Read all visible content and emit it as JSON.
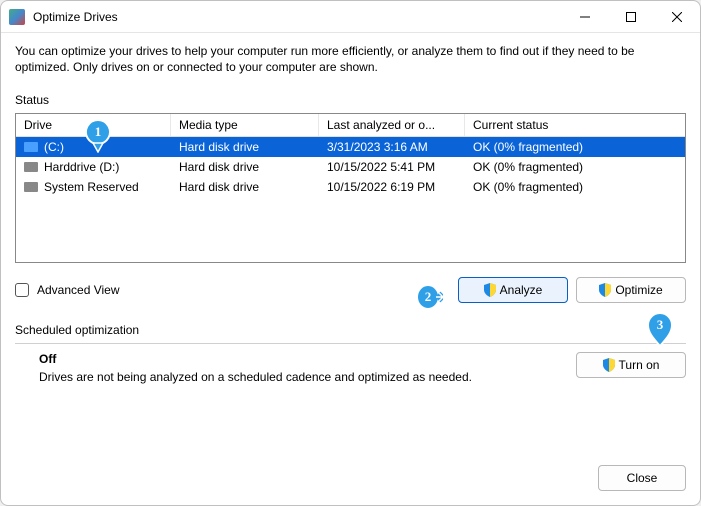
{
  "window": {
    "title": "Optimize Drives"
  },
  "description": "You can optimize your drives to help your computer run more efficiently, or analyze them to find out if they need to be optimized. Only drives on or connected to your computer are shown.",
  "status_label": "Status",
  "columns": {
    "drive": "Drive",
    "media": "Media type",
    "last": "Last analyzed or o...",
    "status": "Current status"
  },
  "rows": [
    {
      "drive": "(C:)",
      "media": "Hard disk drive",
      "last": "3/31/2023 3:16 AM",
      "status": "OK (0% fragmented)",
      "selected": true,
      "icon": "blue"
    },
    {
      "drive": "Harddrive (D:)",
      "media": "Hard disk drive",
      "last": "10/15/2022 5:41 PM",
      "status": "OK (0% fragmented)",
      "selected": false,
      "icon": "grey"
    },
    {
      "drive": "System Reserved",
      "media": "Hard disk drive",
      "last": "10/15/2022 6:19 PM",
      "status": "OK (0% fragmented)",
      "selected": false,
      "icon": "grey"
    }
  ],
  "advanced_view": "Advanced View",
  "buttons": {
    "analyze": "Analyze",
    "optimize": "Optimize",
    "turn_on": "Turn on",
    "close": "Close"
  },
  "schedule": {
    "header": "Scheduled optimization",
    "state": "Off",
    "detail": "Drives are not being analyzed on a scheduled cadence and optimized as needed."
  },
  "annotations": {
    "a1": "1",
    "a2": "2",
    "a3": "3"
  }
}
